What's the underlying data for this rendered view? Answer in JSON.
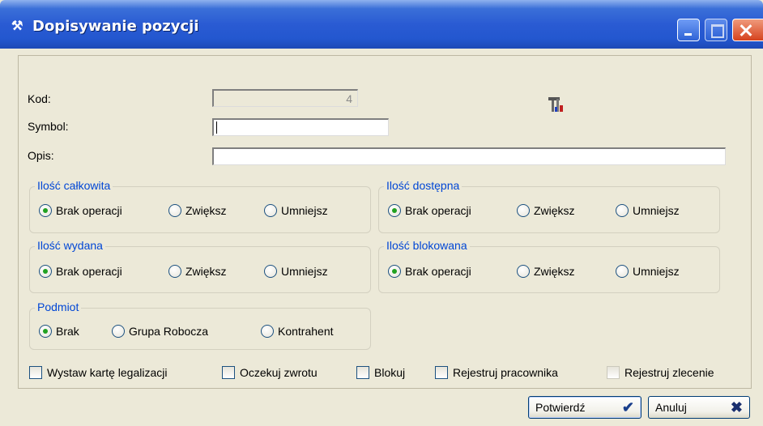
{
  "window": {
    "title": "Dopisywanie pozycji",
    "icon": "hammer-icon"
  },
  "form": {
    "kod_label": "Kod:",
    "kod_value": "4",
    "symbol_label": "Symbol:",
    "symbol_value": "",
    "opis_label": "Opis:",
    "opis_value": ""
  },
  "groups": {
    "ilosc_calkowita": {
      "title": "Ilość całkowita",
      "options": [
        "Brak operacji",
        "Zwiększ",
        "Umniejsz"
      ],
      "selected": "Brak operacji"
    },
    "ilosc_dostepna": {
      "title": "Ilość dostępna",
      "options": [
        "Brak operacji",
        "Zwiększ",
        "Umniejsz"
      ],
      "selected": "Brak operacji"
    },
    "ilosc_wydana": {
      "title": "Ilość wydana",
      "options": [
        "Brak operacji",
        "Zwiększ",
        "Umniejsz"
      ],
      "selected": "Brak operacji"
    },
    "ilosc_blokowana": {
      "title": "Ilość blokowana",
      "options": [
        "Brak operacji",
        "Zwiększ",
        "Umniejsz"
      ],
      "selected": "Brak operacji"
    },
    "podmiot": {
      "title": "Podmiot",
      "options": [
        "Brak",
        "Grupa Robocza",
        "Kontrahent"
      ],
      "selected": "Brak"
    }
  },
  "checkboxes": [
    {
      "label": "Wystaw kartę legalizacji",
      "checked": false
    },
    {
      "label": "Oczekuj zwrotu",
      "checked": false
    },
    {
      "label": "Blokuj",
      "checked": false
    },
    {
      "label": "Rejestruj pracownika",
      "checked": false
    },
    {
      "label": "Rejestruj zlecenie",
      "checked": false
    }
  ],
  "buttons": {
    "confirm_label": "Potwierdź",
    "cancel_label": "Anuluj"
  }
}
